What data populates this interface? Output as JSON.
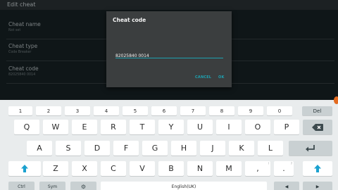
{
  "app": {
    "title": "Edit cheat",
    "fields": [
      {
        "label": "Cheat name",
        "value": "Not set"
      },
      {
        "label": "Cheat type",
        "value": "Code Breaker"
      },
      {
        "label": "Cheat code",
        "value": "82025840 0014"
      }
    ]
  },
  "dialog": {
    "title": "Cheat code",
    "input_value": "82025840 0014",
    "cancel_label": "CANCEL",
    "ok_label": "OK"
  },
  "keyboard": {
    "number_row": [
      "1",
      "2",
      "3",
      "4",
      "5",
      "6",
      "7",
      "8",
      "9",
      "0"
    ],
    "del_label": "Del",
    "row1": [
      "Q",
      "W",
      "E",
      "R",
      "T",
      "Y",
      "U",
      "I",
      "O",
      "P"
    ],
    "row2": [
      "A",
      "S",
      "D",
      "F",
      "G",
      "H",
      "J",
      "K",
      "L"
    ],
    "row3": [
      "Z",
      "X",
      "C",
      "V",
      "B",
      "N",
      "M",
      ",",
      "."
    ],
    "row3_sub": [
      "",
      "",
      "",
      "",
      "",
      "",
      "",
      "!",
      "?"
    ],
    "ctrl_label": "Ctrl",
    "sym_label": "Sym",
    "space_label": "English(UK)"
  },
  "colors": {
    "accent": "#1ea1b0",
    "shift_arrow": "#1ba1cf"
  }
}
